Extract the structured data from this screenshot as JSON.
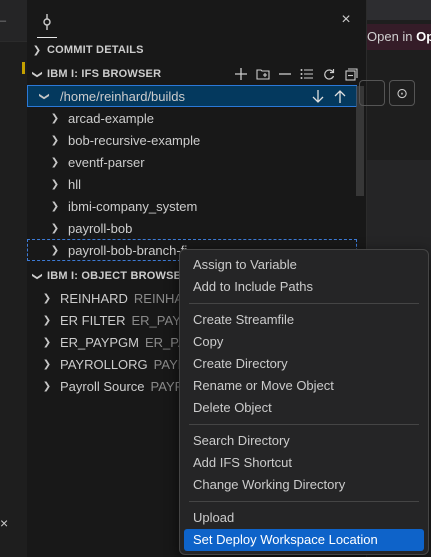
{
  "sidebar": {
    "sections": {
      "commit_details": {
        "title": "COMMIT DETAILS"
      },
      "ifs_browser": {
        "title": "IBM I: IFS BROWSER",
        "root": "/home/reinhard/builds",
        "items": [
          {
            "label": "arcad-example"
          },
          {
            "label": "bob-recursive-example"
          },
          {
            "label": "eventf-parser"
          },
          {
            "label": "hll"
          },
          {
            "label": "ibmi-company_system"
          },
          {
            "label": "payroll-bob"
          },
          {
            "label": "payroll-bob-branch-fi"
          }
        ]
      },
      "object_browser": {
        "title": "IBM I: OBJECT BROWSER",
        "items": [
          {
            "label": "REINHARD",
            "detail": "REINHAR"
          },
          {
            "label": "ER FILTER",
            "detail": "ER_PAYP"
          },
          {
            "label": "ER_PAYPGM",
            "detail": "ER_PAYP"
          },
          {
            "label": "PAYROLLORG",
            "detail": "PAYR"
          },
          {
            "label": "Payroll Source",
            "detail": "PAYR"
          }
        ]
      }
    }
  },
  "editor": {
    "banner": {
      "text": "Open in",
      "emphasis": "Op"
    }
  },
  "context_menu": {
    "groups": [
      [
        "Assign to Variable",
        "Add to Include Paths"
      ],
      [
        "Create Streamfile",
        "Copy",
        "Create Directory",
        "Rename or Move Object",
        "Delete Object"
      ],
      [
        "Search Directory",
        "Add IFS Shortcut",
        "Change Working Directory"
      ],
      [
        "Upload",
        "Set Deploy Workspace Location"
      ]
    ],
    "active_item": "Set Deploy Workspace Location"
  },
  "icons": {
    "section_actions": [
      "add-icon",
      "new-folder-icon",
      "collapse-icon",
      "list-sort-icon",
      "refresh-icon",
      "collapse-all-icon"
    ],
    "row_actions": [
      "arrow-down-icon",
      "arrow-up-icon"
    ]
  },
  "colors": {
    "selection": "#04395e",
    "menu_highlight": "#0e63c9",
    "accent_border": "#2b79d8"
  }
}
